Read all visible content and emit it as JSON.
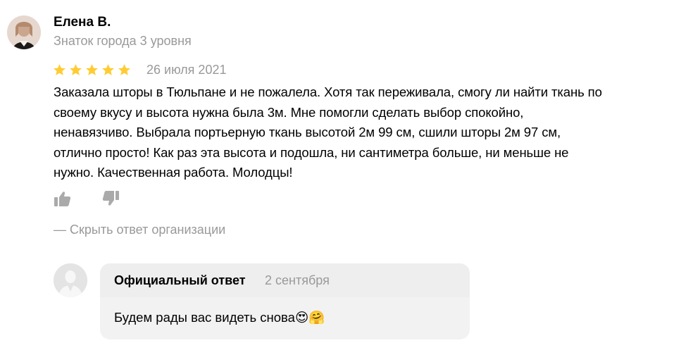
{
  "review": {
    "author_name": "Елена В.",
    "author_level": "Знаток города 3 уровня",
    "rating": 5,
    "rating_max": 5,
    "star_color": "#ffcc33",
    "date": "26 июля 2021",
    "text": "Заказала шторы в Тюльпане и не пожалела. Хотя так переживала, смогу ли найти ткань по\nсвоему вкусу и высота нужна была 3м. Мне помогли сделать выбор спокойно,\nненавязчиво. Выбрала портьерную ткань высотой 2м 99 см, сшили шторы 2м 97 см,\nотлично просто! Как раз эта высота и подошла, ни сантиметра больше, ни меньше не\nнужно. Качественная работа. Молодцы!"
  },
  "actions": {
    "like_icon": "thumbs-up-icon",
    "dislike_icon": "thumbs-down-icon",
    "hide_reply_label": "— Скрыть ответ организации"
  },
  "reply": {
    "title": "Официальный ответ",
    "date": "2 сентября",
    "text": "Будем рады вас видеть снова😍🤗",
    "avatar_icon": "person-silhouette-icon"
  },
  "colors": {
    "muted_text": "#999999",
    "bubble_bg": "#f2f2f2",
    "bubble_head_bg": "#eeeeee",
    "icon_gray": "#aaaaaa"
  }
}
